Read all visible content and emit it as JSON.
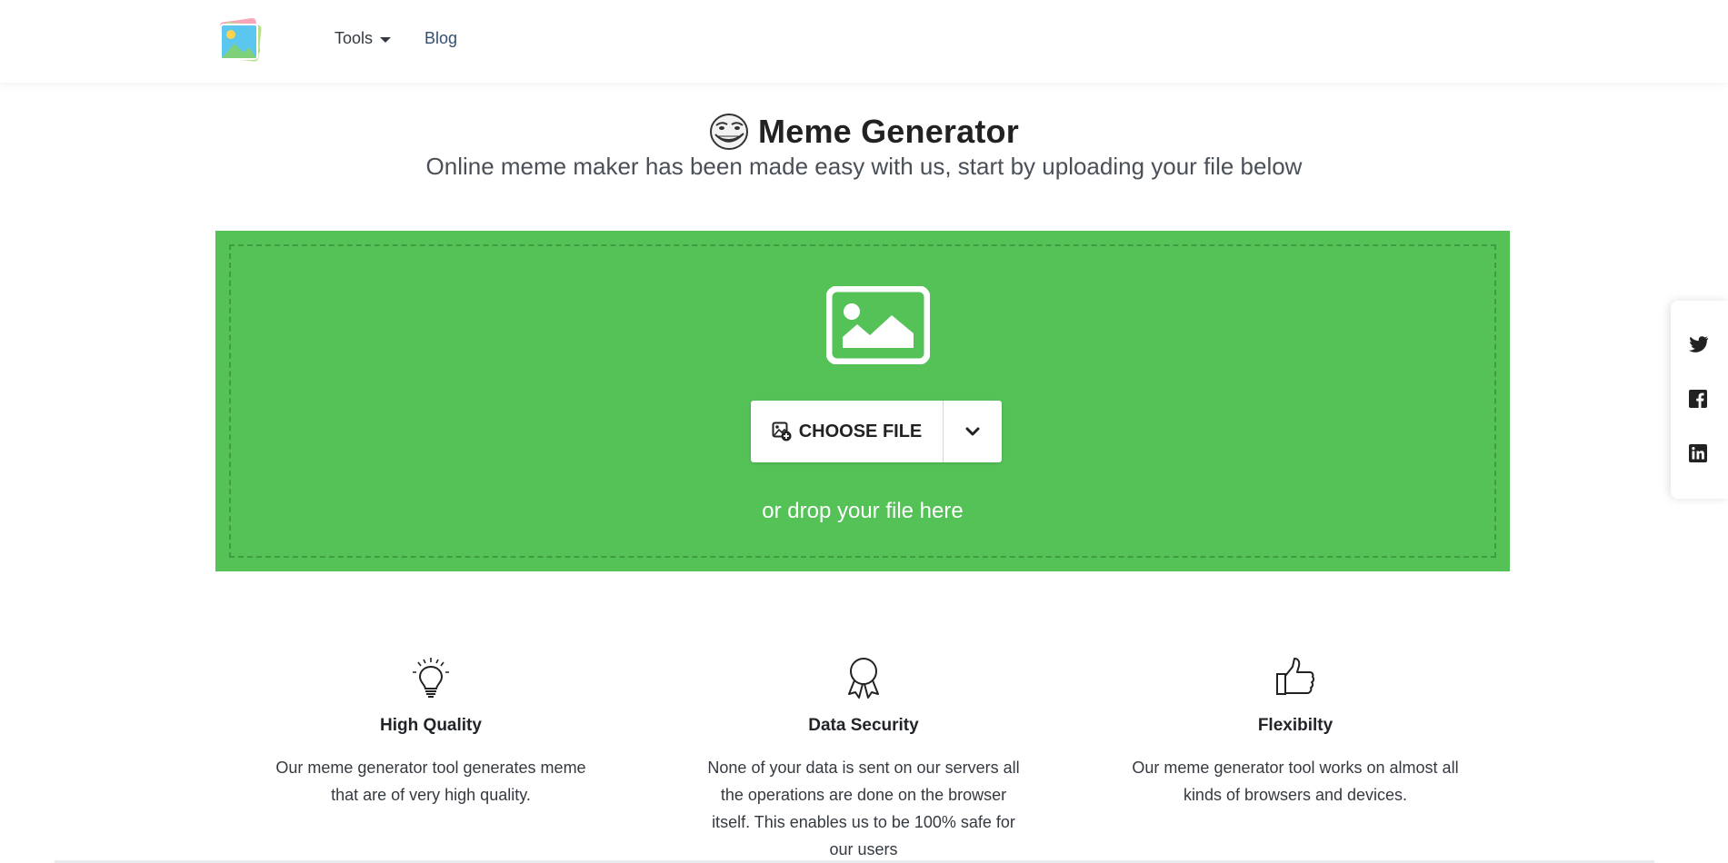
{
  "nav": {
    "tools_label": "Tools",
    "blog_label": "Blog"
  },
  "hero": {
    "title": "Meme Generator",
    "subtitle": "Online meme maker has been made easy with us, start by uploading your file below"
  },
  "upload": {
    "choose_file_label": "CHOOSE FILE",
    "drop_text": "or drop your file here",
    "zone_color": "#54c256"
  },
  "features": [
    {
      "icon": "lightbulb-icon",
      "title": "High Quality",
      "text": "Our meme generator tool generates meme that are of very high quality."
    },
    {
      "icon": "award-ribbon-icon",
      "title": "Data Security",
      "text": "None of your data is sent on our servers all the operations are done on the browser itself. This enables us to be 100% safe for our users"
    },
    {
      "icon": "thumbs-up-icon",
      "title": "Flexibilty",
      "text": "Our meme generator tool works on almost all kinds of browsers and devices."
    }
  ],
  "share": {
    "icons": [
      "twitter-icon",
      "facebook-icon",
      "linkedin-icon"
    ]
  }
}
